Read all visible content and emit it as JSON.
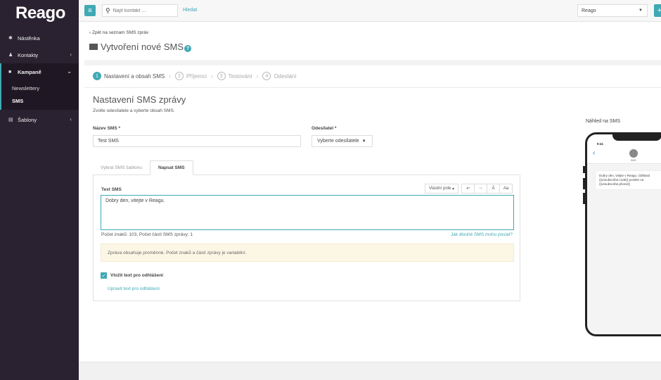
{
  "brand": {
    "logo": "Reago",
    "accent": "#3fa9b4",
    "sidebar_bg": "#2a2230"
  },
  "sidebar": {
    "items": [
      {
        "label": "Nástěnka",
        "icon": "gauge-icon"
      },
      {
        "label": "Kontakty",
        "icon": "users-icon"
      },
      {
        "label": "Kampaně",
        "icon": "envelope-icon"
      },
      {
        "label": "Šablony",
        "icon": "template-icon"
      }
    ],
    "subitems": [
      {
        "label": "Newslettery"
      },
      {
        "label": "SMS"
      }
    ]
  },
  "topbar": {
    "search_placeholder": "Najít kontakt ...",
    "search_button": "Hledat",
    "account": "Reago",
    "plus": "+"
  },
  "page": {
    "back_link": "‹ Zpět na seznam SMS zpráv",
    "title": "Vytvoření nové SMS",
    "help": "?"
  },
  "steps": [
    {
      "num": "1",
      "label": "Nastavení a obsah SMS"
    },
    {
      "num": "2",
      "label": "Příjemci"
    },
    {
      "num": "3",
      "label": "Testování"
    },
    {
      "num": "4",
      "label": "Odeslání"
    }
  ],
  "form": {
    "section_title": "Nastavení SMS zprávy",
    "section_sub": "Zvolte odesílatele a vyberte obsah SMS.",
    "name_label": "Název SMS *",
    "name_value": "Test SMS",
    "sender_label": "Odesílatel *",
    "sender_value": "Vyberte odesílatele",
    "tabs": [
      {
        "label": "Vybrat SMS šablonu"
      },
      {
        "label": "Napsat SMS"
      }
    ],
    "sms_label": "Text SMS",
    "toolbar": {
      "fields": "Vlastní pole",
      "undo": "↶",
      "redo": "↷",
      "special": "Ă",
      "case": "Aa"
    },
    "sms_text": "Dobry den, vitejte v Reagu.",
    "counter": "Počet znaků: 103, Počet částí SMS zprávy: 1",
    "long_link": "Jak dlouhé SMS mohu poslat?",
    "warning": "Zpráva obsahuje proměnné. Počet znaků a částí zprávy je variabilní.",
    "checkbox_label": "Vložit text pro odhlášení",
    "edit_link": "Upravit text pro odhlášení"
  },
  "preview": {
    "label": "Náhled na SMS",
    "time": "9:41",
    "contact": "SMS",
    "message": "Dobry den, vitejte v Reagu. Odhlasit {{unsubscribe.code}} poslete na {{unsubscribe.phone}}"
  }
}
